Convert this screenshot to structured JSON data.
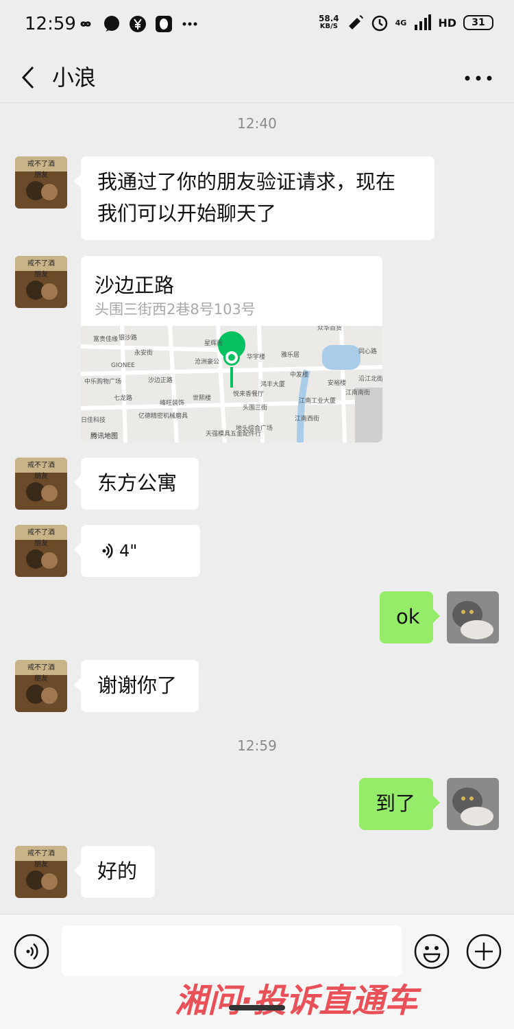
{
  "status_bar": {
    "time": "12:59",
    "net_speed_value": "58.4",
    "net_speed_unit": "KB/S",
    "network_type": "4G",
    "hd_label": "HD",
    "battery": "31"
  },
  "header": {
    "back_icon": "chevron-left-icon",
    "title": "小浪",
    "more_icon": "more-dots-icon"
  },
  "messages": [
    {
      "type": "timestamp",
      "text": "12:40"
    },
    {
      "type": "text",
      "side": "left",
      "text_lines": [
        "我通过了你的朋友验证请求，现在",
        "我们可以开始聊天了"
      ]
    },
    {
      "type": "location",
      "side": "left",
      "name": "沙边正路",
      "address": "头围三街西2巷8号103号",
      "map_labels": [
        "众华百货",
        "银沙路",
        "永安街",
        "富贵佳缘",
        "星辉阁",
        "华宇楼",
        "雅乐居",
        "同心路",
        "GIONEE",
        "沙边正路",
        "沧洲豪公",
        "中发楼",
        "沿江北街",
        "中乐购物广场",
        "鸿丰大厦",
        "安裕楼",
        "世熙楼",
        "悦来香餐厅",
        "江南南街",
        "七龙路",
        "峰旺装饰",
        "头围三街",
        "江南工业大厦",
        "日佳科技",
        "亿德精密机械磨具",
        "天强模具五金配件行",
        "地头综合广场",
        "江南西街",
        "腾讯地图"
      ]
    },
    {
      "type": "text",
      "side": "left",
      "text": "东方公寓"
    },
    {
      "type": "voice",
      "side": "left",
      "duration": "4\""
    },
    {
      "type": "text",
      "side": "right",
      "text": "ok"
    },
    {
      "type": "text",
      "side": "left",
      "text": "谢谢你了"
    },
    {
      "type": "timestamp",
      "text": "12:59"
    },
    {
      "type": "text",
      "side": "right",
      "text": "到了"
    },
    {
      "type": "text",
      "side": "left",
      "text": "好的"
    }
  ],
  "input_bar": {
    "voice_icon": "voice-mode-icon",
    "emoji_icon": "emoji-icon",
    "plus_icon": "plus-icon"
  },
  "watermark": {
    "text": "湘问·投诉直通车",
    "color": "#e8343c"
  },
  "colors": {
    "background": "#ededed",
    "sent_bubble": "#95ec69",
    "received_bubble": "#ffffff",
    "location_pin": "#07c160"
  }
}
